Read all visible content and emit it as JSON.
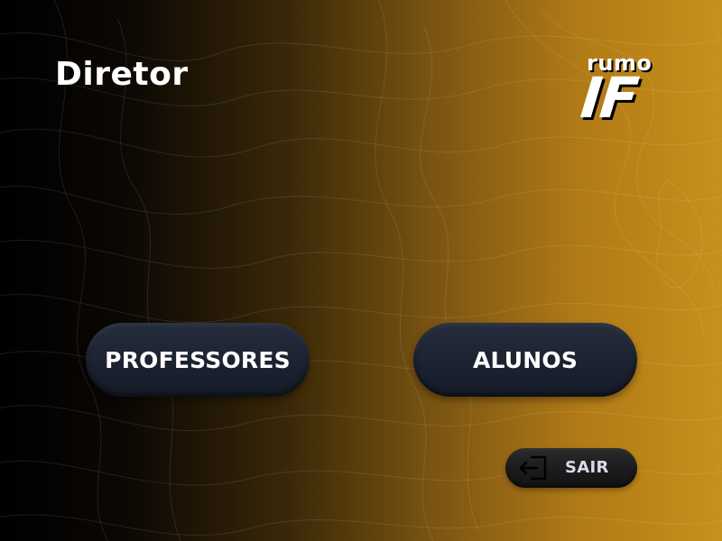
{
  "header": {
    "title": "Diretor"
  },
  "logo": {
    "line1": "rumo",
    "line2": "IF"
  },
  "actions": {
    "professores_label": "PROFESSORES",
    "alunos_label": "ALUNOS"
  },
  "logout": {
    "label": "SAIR",
    "icon": "logout-icon"
  },
  "colors": {
    "background_left": "#000000",
    "background_right": "#c8901c",
    "button_bg": "#1f2535",
    "logout_bg": "#1c1c1c",
    "text": "#ffffff"
  }
}
